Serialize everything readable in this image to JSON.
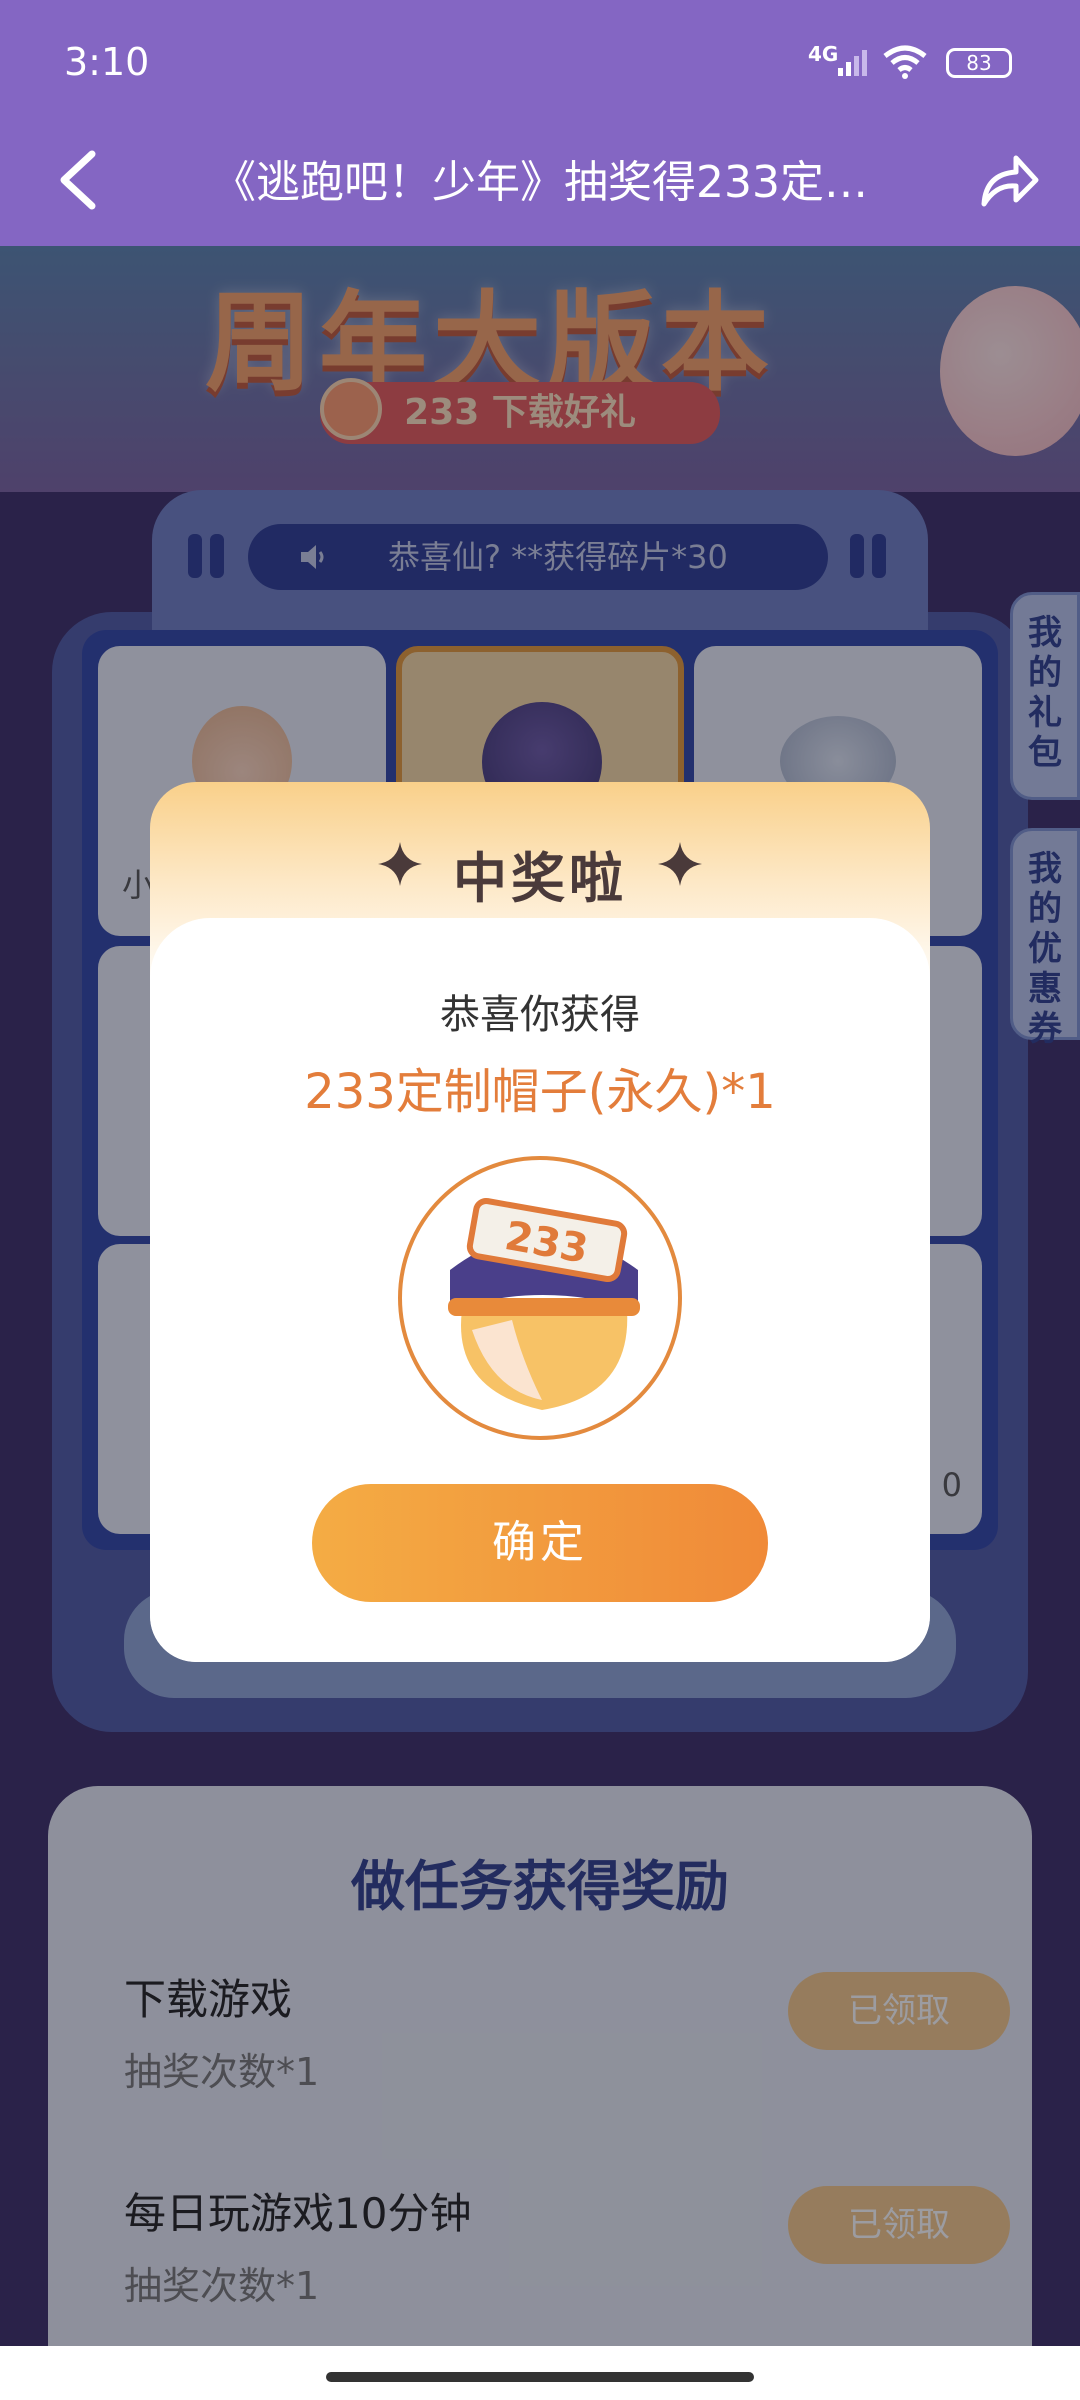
{
  "status": {
    "time": "3:10",
    "network": "4G",
    "battery": "83"
  },
  "nav": {
    "title": "《逃跑吧！少年》抽奖得233定…"
  },
  "banner": {
    "headline": "周年大版本",
    "subtitle": "233 下载好礼"
  },
  "ticker": {
    "text": "恭喜仙? **获得碎片*30"
  },
  "grid": {
    "cell_left_label": "小",
    "cell_right_label": "0"
  },
  "side_tabs": {
    "gifts": "我的礼包",
    "coupons": "我的优惠券"
  },
  "tasks": {
    "heading": "做任务获得奖励",
    "items": [
      {
        "name": "下载游戏",
        "count": "抽奖次数*1",
        "button": "已领取"
      },
      {
        "name": "每日玩游戏10分钟",
        "count": "抽奖次数*1",
        "button": "已领取"
      }
    ]
  },
  "modal": {
    "title": "中奖啦",
    "congrats": "恭喜你获得",
    "prize": "233定制帽子(永久)*1",
    "hat_text": "233",
    "confirm": "确定"
  },
  "colors": {
    "header": "#8466c3",
    "accent": "#f08a38",
    "prize": "#e37d3b"
  }
}
